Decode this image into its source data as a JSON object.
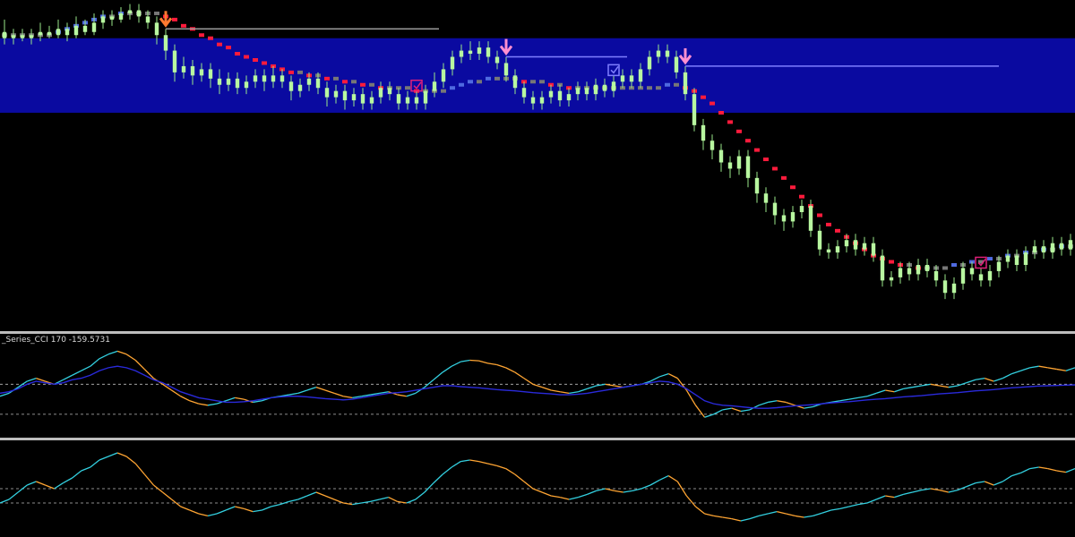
{
  "indicator_label": "_Series_CCI  170 -159.5731",
  "colors": {
    "background": "#000000",
    "zone": "#0a0aa0",
    "candle": "#b8f7a0",
    "candle_wick": "#9ae88a",
    "ma_bull": "#4f6ae0",
    "ma_bear": "#ff1b3c",
    "ma_neutral": "#777777",
    "ma_transition": "#e0207a",
    "arrow_orange": "#ff7a30",
    "arrow_pink": "#ff8fd0",
    "level_line": "#7f7fff",
    "cci_fast": "#ffa533",
    "cci_fast_alt": "#33d0e0",
    "cci_slow": "#2a2adb",
    "grid_dash": "#bbbbbb",
    "separator": "#bdbdbd"
  },
  "chart_data": [
    {
      "type": "candlestick",
      "title": "",
      "price_ylim": [
        0,
        100
      ],
      "zone": {
        "from": 66,
        "to": 90
      },
      "candles": [
        [
          92,
          90,
          96,
          88
        ],
        [
          90,
          91,
          93,
          88
        ],
        [
          91,
          90,
          93,
          89
        ],
        [
          90,
          91,
          93,
          88
        ],
        [
          91,
          92,
          95,
          89
        ],
        [
          92,
          91,
          94,
          90
        ],
        [
          91,
          93,
          96,
          90
        ],
        [
          93,
          91,
          95,
          89
        ],
        [
          91,
          94,
          97,
          90
        ],
        [
          94,
          92,
          96,
          91
        ],
        [
          92,
          95,
          98,
          91
        ],
        [
          95,
          97,
          99,
          93
        ],
        [
          97,
          96,
          99,
          94
        ],
        [
          96,
          98,
          100,
          95
        ],
        [
          98,
          99,
          101,
          96
        ],
        [
          99,
          97,
          101,
          95
        ],
        [
          97,
          95,
          99,
          93
        ],
        [
          95,
          91,
          97,
          88
        ],
        [
          91,
          86,
          93,
          83
        ],
        [
          86,
          79,
          88,
          76
        ],
        [
          79,
          81,
          84,
          77
        ],
        [
          81,
          78,
          83,
          75
        ],
        [
          78,
          80,
          82,
          76
        ],
        [
          80,
          77,
          82,
          74
        ],
        [
          77,
          75,
          80,
          72
        ],
        [
          75,
          77,
          79,
          73
        ],
        [
          77,
          74,
          79,
          72
        ],
        [
          74,
          76,
          78,
          72
        ],
        [
          76,
          78,
          80,
          74
        ],
        [
          78,
          76,
          80,
          73
        ],
        [
          76,
          78,
          81,
          74
        ],
        [
          78,
          76,
          80,
          74
        ],
        [
          76,
          73,
          78,
          70
        ],
        [
          73,
          75,
          77,
          71
        ],
        [
          75,
          77,
          79,
          73
        ],
        [
          77,
          74,
          79,
          72
        ],
        [
          74,
          71,
          76,
          68
        ],
        [
          71,
          73,
          75,
          69
        ],
        [
          73,
          70,
          75,
          67
        ],
        [
          70,
          72,
          74,
          68
        ],
        [
          72,
          69,
          74,
          67
        ],
        [
          69,
          71,
          73,
          67
        ],
        [
          71,
          74,
          76,
          69
        ],
        [
          74,
          72,
          76,
          70
        ],
        [
          72,
          69,
          74,
          67
        ],
        [
          69,
          71,
          73,
          67
        ],
        [
          71,
          69,
          73,
          67
        ],
        [
          69,
          73,
          75,
          67
        ],
        [
          73,
          76,
          79,
          71
        ],
        [
          76,
          80,
          82,
          74
        ],
        [
          80,
          84,
          86,
          78
        ],
        [
          84,
          86,
          88,
          82
        ],
        [
          86,
          85,
          89,
          83
        ],
        [
          85,
          87,
          89,
          83
        ],
        [
          87,
          84,
          89,
          82
        ],
        [
          84,
          82,
          86,
          80
        ],
        [
          82,
          78,
          84,
          76
        ],
        [
          78,
          74,
          80,
          72
        ],
        [
          74,
          71,
          76,
          69
        ],
        [
          71,
          69,
          73,
          67
        ],
        [
          69,
          71,
          73,
          67
        ],
        [
          71,
          73,
          75,
          69
        ],
        [
          73,
          70,
          75,
          68
        ],
        [
          70,
          72,
          74,
          68
        ],
        [
          72,
          74,
          76,
          70
        ],
        [
          74,
          72,
          76,
          70
        ],
        [
          72,
          75,
          77,
          70
        ],
        [
          75,
          73,
          77,
          71
        ],
        [
          73,
          76,
          78,
          71
        ],
        [
          76,
          78,
          80,
          74
        ],
        [
          78,
          76,
          80,
          74
        ],
        [
          76,
          80,
          82,
          74
        ],
        [
          80,
          84,
          86,
          78
        ],
        [
          84,
          86,
          88,
          82
        ],
        [
          86,
          84,
          88,
          82
        ],
        [
          84,
          79,
          86,
          77
        ],
        [
          79,
          72,
          81,
          70
        ],
        [
          72,
          62,
          74,
          60
        ],
        [
          62,
          57,
          64,
          54
        ],
        [
          57,
          54,
          59,
          51
        ],
        [
          54,
          50,
          56,
          47
        ],
        [
          50,
          48,
          52,
          45
        ],
        [
          48,
          52,
          54,
          46
        ],
        [
          52,
          45,
          54,
          42
        ],
        [
          45,
          40,
          47,
          37
        ],
        [
          40,
          37,
          42,
          34
        ],
        [
          37,
          33,
          39,
          30
        ],
        [
          33,
          31,
          35,
          28
        ],
        [
          31,
          34,
          36,
          29
        ],
        [
          34,
          36,
          38,
          32
        ],
        [
          36,
          28,
          38,
          26
        ],
        [
          28,
          22,
          30,
          20
        ],
        [
          22,
          21,
          24,
          19
        ],
        [
          21,
          23,
          25,
          19
        ],
        [
          23,
          25,
          27,
          21
        ],
        [
          25,
          22,
          27,
          20
        ],
        [
          22,
          24,
          26,
          20
        ],
        [
          24,
          20,
          26,
          18
        ],
        [
          20,
          12,
          22,
          10
        ],
        [
          12,
          13,
          15,
          10
        ],
        [
          13,
          16,
          18,
          11
        ],
        [
          16,
          14,
          18,
          12
        ],
        [
          14,
          17,
          19,
          12
        ],
        [
          17,
          15,
          19,
          13
        ],
        [
          15,
          12,
          17,
          10
        ],
        [
          12,
          8,
          14,
          6
        ],
        [
          8,
          11,
          13,
          6
        ],
        [
          11,
          16,
          18,
          9
        ],
        [
          16,
          14,
          18,
          12
        ],
        [
          14,
          12,
          16,
          10
        ],
        [
          12,
          15,
          17,
          10
        ],
        [
          15,
          18,
          20,
          13
        ],
        [
          18,
          20,
          22,
          16
        ],
        [
          20,
          17,
          22,
          15
        ],
        [
          17,
          21,
          23,
          15
        ],
        [
          21,
          23,
          25,
          19
        ],
        [
          23,
          21,
          25,
          19
        ],
        [
          21,
          24,
          26,
          19
        ],
        [
          24,
          22,
          26,
          20
        ],
        [
          22,
          25,
          27,
          20
        ]
      ],
      "moving_average": [
        91,
        91,
        91,
        91,
        91,
        91,
        92,
        93,
        94,
        95,
        96,
        97,
        97,
        98,
        98,
        98,
        98,
        98,
        97,
        96,
        94,
        93,
        91,
        90,
        88,
        87,
        85,
        84,
        83,
        82,
        81,
        80,
        79,
        79,
        78,
        78,
        77,
        77,
        76,
        76,
        75,
        75,
        74,
        74,
        74,
        74,
        73,
        73,
        73,
        73,
        74,
        75,
        76,
        76,
        77,
        77,
        77,
        77,
        76,
        76,
        76,
        75,
        75,
        74,
        74,
        74,
        74,
        74,
        74,
        74,
        74,
        74,
        74,
        74,
        75,
        75,
        74,
        73,
        71,
        69,
        66,
        63,
        60,
        57,
        54,
        51,
        48,
        45,
        42,
        39,
        36,
        33,
        30,
        28,
        26,
        24,
        22,
        20,
        19,
        18,
        17,
        17,
        16,
        16,
        16,
        16,
        17,
        17,
        18,
        18,
        19,
        19,
        20,
        20,
        21,
        21,
        22,
        22,
        23,
        23
      ],
      "signals": [
        {
          "kind": "arrow-down",
          "index": 18,
          "color": "orange"
        },
        {
          "kind": "check-box",
          "index": 46,
          "color": "red"
        },
        {
          "kind": "arrow-down",
          "index": 56,
          "color": "pink"
        },
        {
          "kind": "check-box",
          "index": 68,
          "color": "blue"
        },
        {
          "kind": "arrow-down",
          "index": 76,
          "color": "pink"
        },
        {
          "kind": "check-box",
          "index": 109,
          "color": "red"
        }
      ]
    },
    {
      "type": "line",
      "title": "_Series_CCI  170 -159.5731",
      "series": [
        {
          "values": [
            -40,
            -30,
            -10,
            10,
            20,
            10,
            0,
            15,
            30,
            45,
            60,
            85,
            100,
            110,
            100,
            80,
            50,
            20,
            0,
            -20,
            -40,
            -55,
            -65,
            -70,
            -65,
            -55,
            -45,
            -50,
            -60,
            -55,
            -45,
            -40,
            -35,
            -30,
            -20,
            -10,
            -20,
            -30,
            -40,
            -45,
            -40,
            -35,
            -30,
            -25,
            -35,
            -40,
            -30,
            -10,
            15,
            40,
            60,
            75,
            80,
            78,
            70,
            65,
            55,
            40,
            20,
            0,
            -10,
            -20,
            -25,
            -30,
            -25,
            -15,
            -5,
            0,
            -5,
            -10,
            -5,
            0,
            10,
            25,
            35,
            20,
            -20,
            -70,
            -110,
            -100,
            -85,
            -80,
            -90,
            -85,
            -70,
            -60,
            -55,
            -60,
            -70,
            -80,
            -75,
            -65,
            -60,
            -55,
            -50,
            -45,
            -40,
            -30,
            -20,
            -25,
            -15,
            -10,
            -5,
            0,
            -5,
            -10,
            -5,
            5,
            15,
            20,
            10,
            20,
            35,
            45,
            55,
            60,
            55,
            50,
            45,
            55
          ]
        },
        {
          "values": [
            -30,
            -25,
            -15,
            0,
            10,
            5,
            0,
            5,
            15,
            20,
            30,
            45,
            55,
            60,
            55,
            45,
            30,
            15,
            5,
            -10,
            -25,
            -35,
            -45,
            -50,
            -55,
            -60,
            -60,
            -58,
            -55,
            -50,
            -45,
            -42,
            -40,
            -40,
            -42,
            -45,
            -48,
            -50,
            -52,
            -50,
            -45,
            -40,
            -35,
            -30,
            -28,
            -25,
            -20,
            -15,
            -10,
            -5,
            -5,
            -8,
            -10,
            -12,
            -15,
            -18,
            -20,
            -22,
            -25,
            -28,
            -30,
            -32,
            -35,
            -35,
            -33,
            -30,
            -25,
            -20,
            -15,
            -10,
            -5,
            0,
            5,
            10,
            8,
            0,
            -15,
            -35,
            -55,
            -65,
            -70,
            -72,
            -75,
            -78,
            -80,
            -80,
            -78,
            -75,
            -72,
            -70,
            -68,
            -65,
            -62,
            -60,
            -58,
            -55,
            -52,
            -50,
            -48,
            -45,
            -42,
            -40,
            -38,
            -35,
            -32,
            -30,
            -28,
            -25,
            -22,
            -20,
            -18,
            -15,
            -12,
            -10,
            -8,
            -6,
            -5,
            -4,
            -3,
            -2
          ]
        }
      ],
      "levels": [
        0,
        -100
      ],
      "ylim": [
        -160,
        150
      ]
    },
    {
      "type": "line",
      "title": "",
      "series": [
        {
          "values": [
            -20,
            -15,
            -5,
            5,
            10,
            5,
            0,
            8,
            15,
            25,
            30,
            40,
            45,
            50,
            45,
            35,
            20,
            5,
            -5,
            -15,
            -25,
            -30,
            -35,
            -38,
            -35,
            -30,
            -25,
            -28,
            -32,
            -30,
            -25,
            -22,
            -18,
            -15,
            -10,
            -5,
            -10,
            -15,
            -20,
            -22,
            -20,
            -18,
            -15,
            -12,
            -18,
            -20,
            -15,
            -5,
            8,
            20,
            30,
            38,
            40,
            38,
            35,
            32,
            28,
            20,
            10,
            0,
            -5,
            -10,
            -12,
            -15,
            -12,
            -8,
            -3,
            0,
            -3,
            -5,
            -3,
            0,
            5,
            12,
            18,
            10,
            -10,
            -25,
            -35,
            -38,
            -40,
            -42,
            -45,
            -42,
            -38,
            -35,
            -32,
            -35,
            -38,
            -40,
            -38,
            -34,
            -30,
            -28,
            -25,
            -22,
            -20,
            -15,
            -10,
            -12,
            -8,
            -5,
            -2,
            0,
            -2,
            -5,
            -2,
            3,
            8,
            10,
            5,
            10,
            18,
            22,
            28,
            30,
            28,
            25,
            23,
            28
          ]
        }
      ],
      "levels": [
        0,
        -20
      ],
      "ylim": [
        -60,
        60
      ]
    }
  ]
}
